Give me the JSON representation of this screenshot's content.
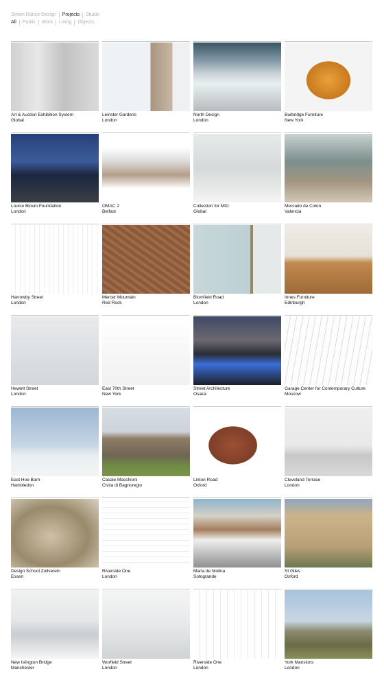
{
  "nav": {
    "sections": [
      {
        "label": "Simon Dance Design",
        "active": false
      },
      {
        "label": "Projects",
        "active": true
      },
      {
        "label": "Studio",
        "active": false
      }
    ],
    "filters": [
      {
        "label": "All",
        "active": true
      },
      {
        "label": "Public",
        "active": false
      },
      {
        "label": "Work",
        "active": false
      },
      {
        "label": "Living",
        "active": false
      },
      {
        "label": "Objects",
        "active": false
      }
    ]
  },
  "projects": [
    {
      "title": "Art & Auction Exhibition System",
      "location": "Global",
      "thumb": "bg-art"
    },
    {
      "title": "Leinster Gardens",
      "location": "London",
      "thumb": "bg-leinster"
    },
    {
      "title": "North Design",
      "location": "London",
      "thumb": "bg-north"
    },
    {
      "title": "Burbridge Furniture",
      "location": "New York",
      "thumb": "bg-burbridge"
    },
    {
      "title": "Louise Blouin Foundation",
      "location": "London",
      "thumb": "bg-blouin"
    },
    {
      "title": "OMAC 2",
      "location": "Belfast",
      "thumb": "bg-omac"
    },
    {
      "title": "Collection for MID",
      "location": "Global",
      "thumb": "bg-mid"
    },
    {
      "title": "Mercado de Colon",
      "location": "Valencia",
      "thumb": "bg-mercado"
    },
    {
      "title": "Harrowby Street",
      "location": "London",
      "thumb": "bg-harrowby"
    },
    {
      "title": "Mercer Mountain",
      "location": "Red Rock",
      "thumb": "bg-mercer"
    },
    {
      "title": "Blomfield Road",
      "location": "London",
      "thumb": "bg-blomfield"
    },
    {
      "title": "Innes Furniture",
      "location": "Edinburgh",
      "thumb": "bg-innes"
    },
    {
      "title": "Hewett Street",
      "location": "London",
      "thumb": "bg-hewett"
    },
    {
      "title": "East 70th Street",
      "location": "New York",
      "thumb": "bg-east70"
    },
    {
      "title": "Street Architecture",
      "location": "Osaka",
      "thumb": "bg-street"
    },
    {
      "title": "Garage Center for Contemporary Culture",
      "location": "Moscow",
      "thumb": "bg-garage"
    },
    {
      "title": "East Hoe Barn",
      "location": "Hambledon",
      "thumb": "bg-easthoe"
    },
    {
      "title": "Casale Macchioni",
      "location": "Civita di Bagnoregio",
      "thumb": "bg-casale"
    },
    {
      "title": "Linton Road",
      "location": "Oxford",
      "thumb": "bg-linton"
    },
    {
      "title": "Cleveland Terrace",
      "location": "London",
      "thumb": "bg-cleveland"
    },
    {
      "title": "Design School Zollverein",
      "location": "Essen",
      "thumb": "bg-zoll"
    },
    {
      "title": "Riverside One",
      "location": "London",
      "thumb": "bg-river1"
    },
    {
      "title": "Maria de Molina",
      "location": "Sotogrande",
      "thumb": "bg-molina"
    },
    {
      "title": "St Giles",
      "location": "Oxford",
      "thumb": "bg-giles"
    },
    {
      "title": "New Islington Bridge",
      "location": "Manchester",
      "thumb": "bg-islington"
    },
    {
      "title": "Worfield Street",
      "location": "London",
      "thumb": "bg-worfield"
    },
    {
      "title": "Riverside One",
      "location": "London",
      "thumb": "bg-river2"
    },
    {
      "title": "York Mansions",
      "location": "London",
      "thumb": "bg-york"
    }
  ]
}
